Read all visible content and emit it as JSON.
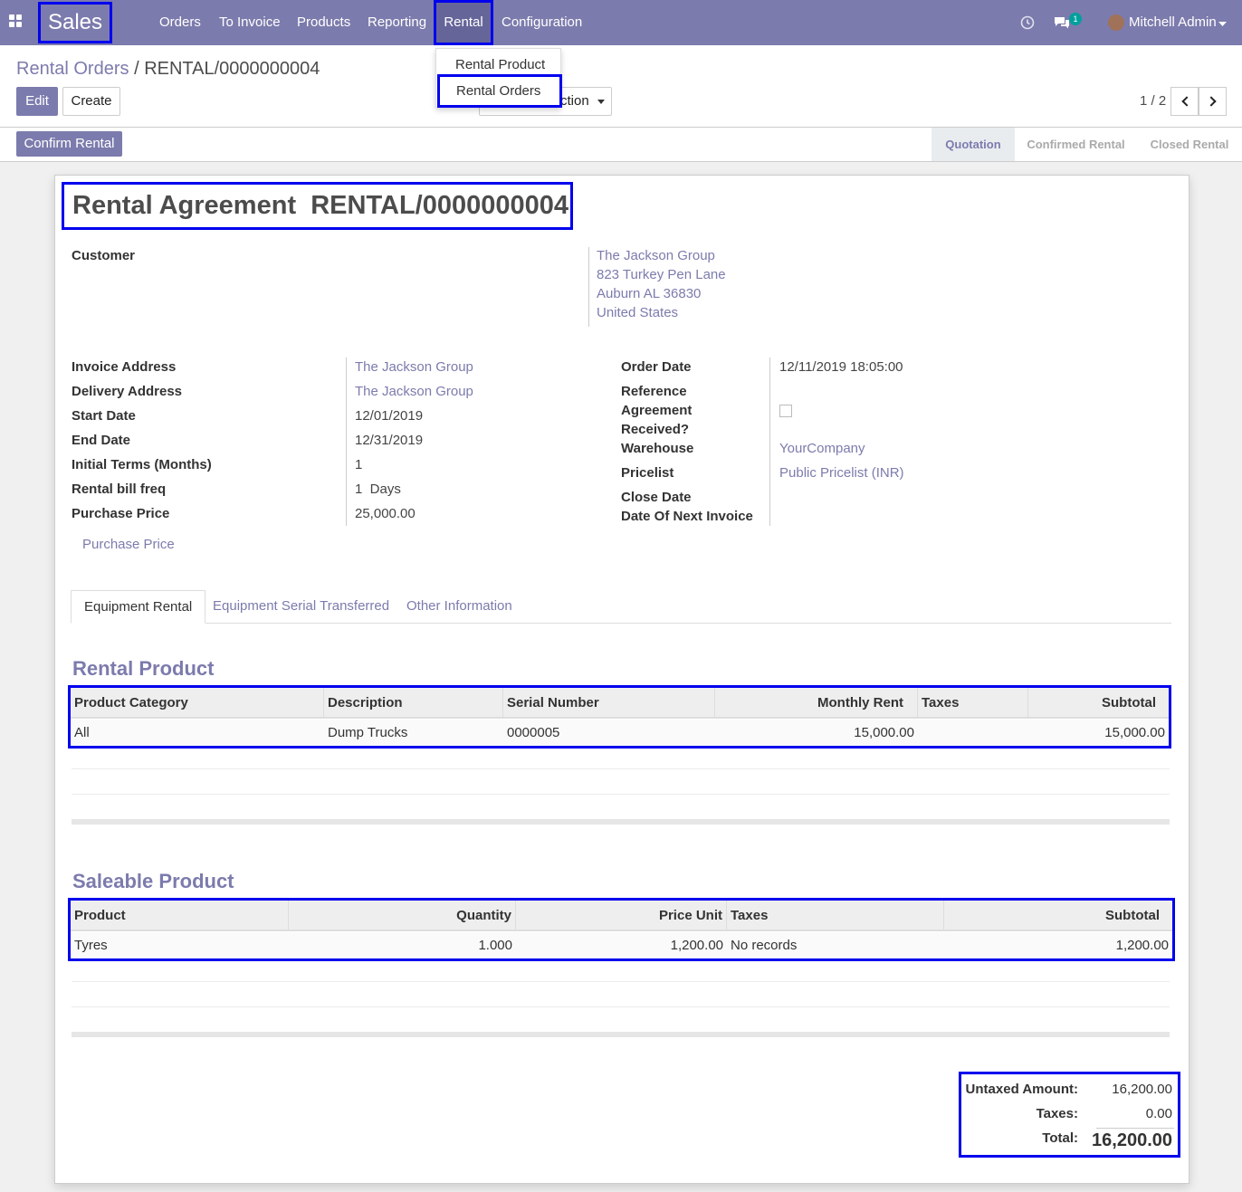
{
  "navbar": {
    "app_name": "Sales",
    "menu": [
      "Orders",
      "To Invoice",
      "Products",
      "Reporting",
      "Rental",
      "Configuration"
    ],
    "active_menu": "Rental",
    "chat_badge": "1",
    "user": "Mitchell Admin"
  },
  "dropdown": {
    "items": [
      "Rental Product",
      "Rental Orders"
    ],
    "highlighted": "Rental Orders"
  },
  "control_panel": {
    "breadcrumb_parent": "Rental Orders",
    "breadcrumb_sep": "/",
    "breadcrumb_current": "RENTAL/0000000004",
    "edit_label": "Edit",
    "create_label": "Create",
    "action_label": "ction",
    "pager": "1 / 2"
  },
  "statusbar": {
    "confirm_label": "Confirm Rental",
    "stages": [
      "Quotation",
      "Confirmed Rental",
      "Closed Rental"
    ],
    "current_stage": "Quotation"
  },
  "form": {
    "title": "Rental Agreement  RENTAL/0000000004",
    "customer_label": "Customer",
    "customer_address": [
      "The Jackson Group",
      "823 Turkey Pen Lane",
      "Auburn AL 36830",
      "United States"
    ],
    "left_fields": [
      {
        "label": "Invoice Address",
        "value": "The Jackson Group",
        "link": true
      },
      {
        "label": "Delivery Address",
        "value": "The Jackson Group",
        "link": true
      },
      {
        "label": "Start Date",
        "value": "12/01/2019",
        "link": false
      },
      {
        "label": "End Date",
        "value": "12/31/2019",
        "link": false
      },
      {
        "label": "Initial Terms (Months)",
        "value": "1",
        "link": false
      },
      {
        "label": "Rental bill freq",
        "value": "1  Days",
        "link": false
      },
      {
        "label": "Purchase Price",
        "value": "25,000.00",
        "link": false
      }
    ],
    "purchase_price_link": "Purchase Price",
    "right_fields": {
      "order_date_label": "Order Date",
      "order_date": "12/11/2019 18:05:00",
      "reference_label": "Reference",
      "agreement_label_1": "Agreement",
      "agreement_label_2": "Received?",
      "warehouse_label": "Warehouse",
      "warehouse": "YourCompany",
      "pricelist_label": "Pricelist",
      "pricelist": "Public Pricelist (INR)",
      "close_date_label": "Close Date",
      "next_invoice_label": "Date Of Next Invoice"
    },
    "tabs": [
      "Equipment Rental",
      "Equipment Serial Transferred",
      "Other Information"
    ],
    "active_tab": "Equipment Rental"
  },
  "rental_product": {
    "section_title": "Rental Product",
    "columns": [
      "Product Category",
      "Description",
      "Serial Number",
      "Monthly Rent",
      "Taxes",
      "Subtotal"
    ],
    "rows": [
      {
        "category": "All",
        "description": "Dump Trucks",
        "serial": "0000005",
        "monthly_rent": "15,000.00",
        "taxes": "",
        "subtotal": "15,000.00"
      }
    ]
  },
  "saleable_product": {
    "section_title": "Saleable Product",
    "columns": [
      "Product",
      "Quantity",
      "Price Unit",
      "Taxes",
      "Subtotal"
    ],
    "rows": [
      {
        "product": "Tyres",
        "quantity": "1.000",
        "price_unit": "1,200.00",
        "taxes": "No records",
        "subtotal": "1,200.00"
      }
    ]
  },
  "totals": {
    "untaxed_label": "Untaxed Amount:",
    "untaxed": "16,200.00",
    "taxes_label": "Taxes:",
    "taxes": "0.00",
    "total_label": "Total:",
    "total": "16,200.00"
  },
  "colors": {
    "brand": "#7c7bad",
    "highlight_border": "#0000ee",
    "badge": "#00a09d"
  }
}
